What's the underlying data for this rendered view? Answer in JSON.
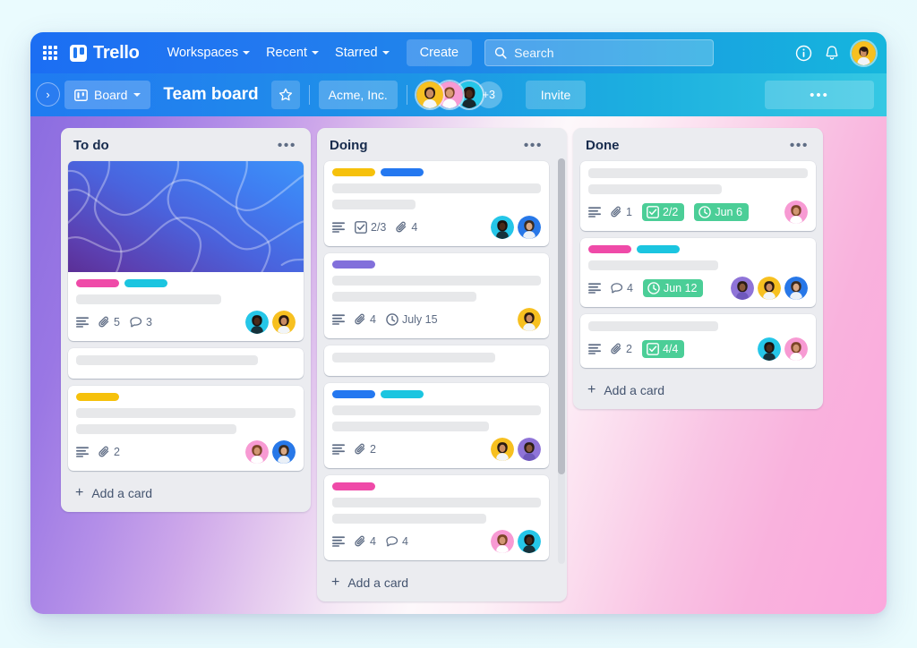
{
  "header": {
    "grid_icon": "apps-grid-icon",
    "brand": "Trello",
    "nav": [
      {
        "label": "Workspaces",
        "has_caret": true
      },
      {
        "label": "Recent",
        "has_caret": true
      },
      {
        "label": "Starred",
        "has_caret": true
      }
    ],
    "create_label": "Create",
    "search": {
      "placeholder": "Search",
      "value": "",
      "icon": "search-icon"
    },
    "info_icon": "info-circle-icon",
    "notification_icon": "bell-icon",
    "account_avatar": "user-avatar"
  },
  "board_nav": {
    "sidebar_toggle": "›",
    "board_chip": {
      "label": "Board",
      "icon": "board-icon",
      "caret": true
    },
    "title": "Team board",
    "star_icon": "star-icon",
    "workspace": "Acme, Inc.",
    "members_more": "+3",
    "invite_label": "Invite",
    "more_label": "•••"
  },
  "colors": {
    "label_pink": "#ef4aa8",
    "label_cyan": "#1bc5e0",
    "label_yellow": "#f6c10b",
    "label_blue": "#2478f0",
    "label_purple": "#8270db",
    "badge_green": "#4bce97",
    "list_bg": "#ebecf0",
    "card_bg": "#ffffff"
  },
  "lists": [
    {
      "title": "To do",
      "menu": "•••",
      "add_card": "Add a card",
      "scroll": false,
      "cards": [
        {
          "cover": true,
          "labels": [
            "#ef4aa8",
            "#1bc5e0"
          ],
          "skeletons": [
            66
          ],
          "badges": [
            {
              "type": "description",
              "text": ""
            },
            {
              "type": "attachment",
              "text": "5"
            },
            {
              "type": "comment",
              "text": "3"
            }
          ],
          "avatars": [
            "#25c6e8",
            "#f7c020"
          ]
        },
        {
          "cover": false,
          "labels": [],
          "skeletons": [
            83
          ],
          "badges": [],
          "avatars": []
        },
        {
          "cover": false,
          "labels": [
            "#f6c10b"
          ],
          "skeletons": [
            100,
            73
          ],
          "badges": [
            {
              "type": "description",
              "text": ""
            },
            {
              "type": "attachment",
              "text": "2"
            }
          ],
          "avatars": [
            "#f79ad3",
            "#2878e8"
          ]
        }
      ]
    },
    {
      "title": "Doing",
      "menu": "•••",
      "add_card": "Add a card",
      "scroll": true,
      "cards": [
        {
          "cover": false,
          "labels": [
            "#f6c10b",
            "#2478f0"
          ],
          "skeletons": [
            100,
            40
          ],
          "badges": [
            {
              "type": "description",
              "text": ""
            },
            {
              "type": "checklist",
              "text": "2/3"
            },
            {
              "type": "attachment",
              "text": "4"
            }
          ],
          "avatars": [
            "#25c6e8",
            "#2878e8"
          ]
        },
        {
          "cover": false,
          "labels": [
            "#8270db"
          ],
          "skeletons": [
            100,
            69
          ],
          "badges": [
            {
              "type": "description",
              "text": ""
            },
            {
              "type": "attachment",
              "text": "4"
            },
            {
              "type": "due",
              "text": "July 15"
            }
          ],
          "avatars": [
            "#f7c020"
          ]
        },
        {
          "cover": false,
          "labels": [],
          "skeletons": [
            78
          ],
          "badges": [],
          "avatars": []
        },
        {
          "cover": false,
          "labels": [
            "#2478f0",
            "#1bc5e0"
          ],
          "skeletons": [
            100,
            75
          ],
          "badges": [
            {
              "type": "description",
              "text": ""
            },
            {
              "type": "attachment",
              "text": "2"
            }
          ],
          "avatars": [
            "#f7c020",
            "#8f74d8"
          ]
        },
        {
          "cover": false,
          "labels": [
            "#ef4aa8"
          ],
          "skeletons": [
            100,
            74
          ],
          "badges": [
            {
              "type": "description",
              "text": ""
            },
            {
              "type": "attachment",
              "text": "4"
            },
            {
              "type": "comment",
              "text": "4"
            }
          ],
          "avatars": [
            "#f79ad3",
            "#25c6e8"
          ]
        }
      ]
    },
    {
      "title": "Done",
      "menu": "•••",
      "add_card": "Add a card",
      "scroll": false,
      "cards": [
        {
          "cover": false,
          "labels": [],
          "skeletons": [
            100,
            61
          ],
          "badges": [
            {
              "type": "description",
              "text": ""
            },
            {
              "type": "attachment",
              "text": "1"
            },
            {
              "type": "checklist-green",
              "text": "2/2"
            },
            {
              "type": "due-green",
              "text": "Jun 6"
            }
          ],
          "avatars": [
            "#f79ad3"
          ]
        },
        {
          "cover": false,
          "labels": [
            "#ef4aa8",
            "#1bc5e0"
          ],
          "skeletons": [
            59
          ],
          "badges": [
            {
              "type": "description",
              "text": ""
            },
            {
              "type": "comment",
              "text": "4"
            },
            {
              "type": "due-green",
              "text": "Jun 12"
            }
          ],
          "avatars": [
            "#8f74d8",
            "#f7c020",
            "#2878e8"
          ]
        },
        {
          "cover": false,
          "labels": [],
          "skeletons": [
            59
          ],
          "badges": [
            {
              "type": "description",
              "text": ""
            },
            {
              "type": "attachment",
              "text": "2"
            },
            {
              "type": "checklist-green",
              "text": "4/4"
            }
          ],
          "avatars": [
            "#25c6e8",
            "#f79ad3"
          ]
        }
      ]
    }
  ]
}
